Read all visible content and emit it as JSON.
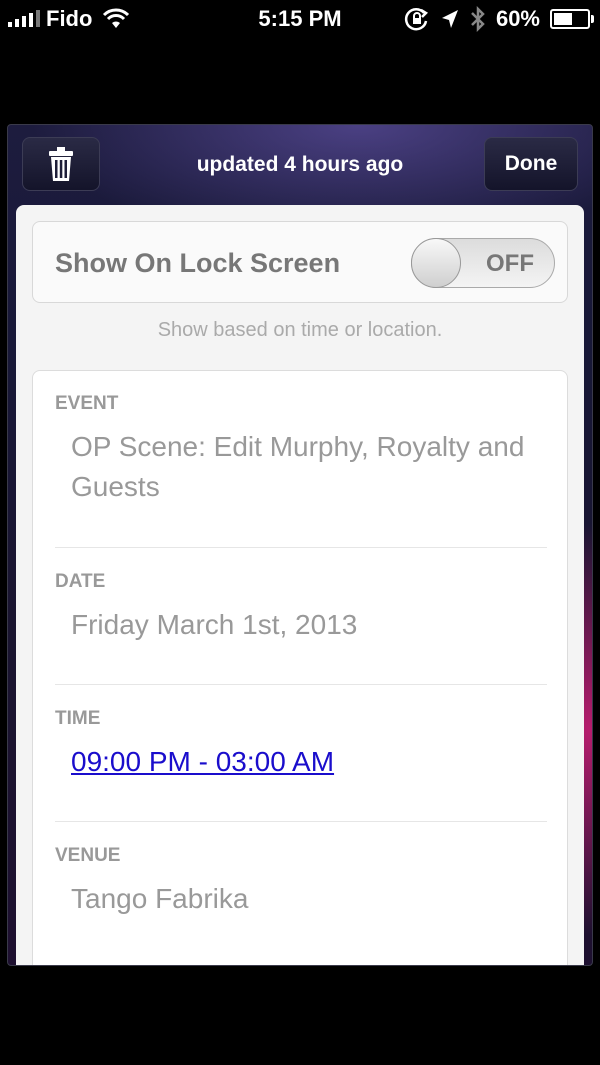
{
  "status_bar": {
    "carrier": "Fido",
    "time": "5:15 PM",
    "battery": "60%",
    "battery_level": 0.6
  },
  "topbar": {
    "title": "updated 4 hours ago",
    "done_label": "Done",
    "trash_icon": "trash-icon"
  },
  "lock_screen": {
    "label": "Show On Lock Screen",
    "toggle_state": "OFF",
    "hint": "Show based on time or location."
  },
  "details": {
    "event": {
      "label": "EVENT",
      "value": "OP Scene: Edit Murphy, Royalty and Guests"
    },
    "date": {
      "label": "DATE",
      "value": "Friday March 1st, 2013"
    },
    "time": {
      "label": "TIME",
      "value": "09:00 PM - 03:00 AM"
    },
    "venue": {
      "label": "VENUE",
      "value": "Tango Fabrika"
    }
  }
}
